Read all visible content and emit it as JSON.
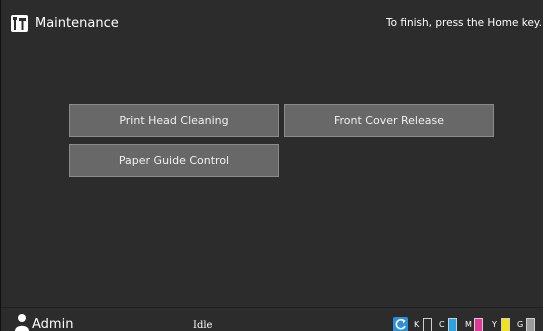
{
  "header": {
    "title": "Maintenance",
    "hint": "To finish, press the Home key.",
    "icon": "tools-icon"
  },
  "buttons": [
    {
      "label": "Print Head Cleaning"
    },
    {
      "label": "Front Cover Release"
    },
    {
      "label": "Paper Guide Control"
    }
  ],
  "statusbar": {
    "user": "Admin",
    "user_icon": "user-icon",
    "status": "Idle",
    "toner_icon": "refresh-icon",
    "toners": [
      {
        "label": "K",
        "color": "#ffffff",
        "level": 0
      },
      {
        "label": "C",
        "color": "#29a3e0",
        "level": 1.0
      },
      {
        "label": "M",
        "color": "#e0399a",
        "level": 1.0
      },
      {
        "label": "Y",
        "color": "#f2e21a",
        "level": 1.0
      },
      {
        "label": "G",
        "color": "#9a9a9a",
        "level": 1.0
      }
    ]
  },
  "colors": {
    "background": "#2c2c2c",
    "button": "#686868",
    "text": "#ffffff"
  }
}
